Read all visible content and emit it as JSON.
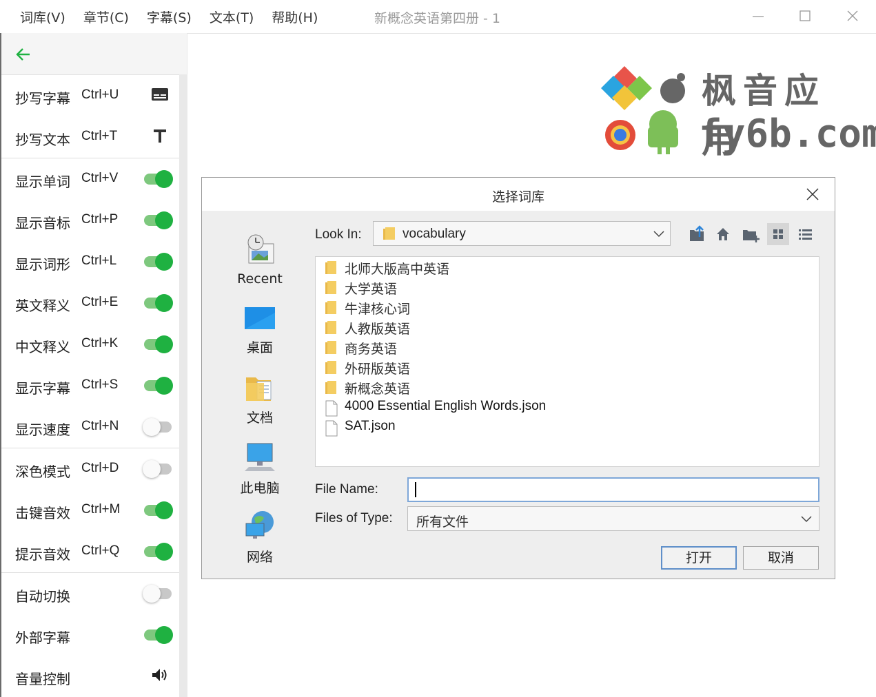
{
  "menubar": {
    "items": [
      "词库(V)",
      "章节(C)",
      "字幕(S)",
      "文本(T)",
      "帮助(H)"
    ],
    "window_title": "新概念英语第四册 - 1"
  },
  "sidebar": {
    "rows": [
      {
        "label": "抄写字幕",
        "shortcut": "Ctrl+U",
        "control": "subtitle-icon"
      },
      {
        "label": "抄写文本",
        "shortcut": "Ctrl+T",
        "control": "text-icon"
      },
      {
        "label": "显示单词",
        "shortcut": "Ctrl+V",
        "control": "toggle",
        "on": true
      },
      {
        "label": "显示音标",
        "shortcut": "Ctrl+P",
        "control": "toggle",
        "on": true
      },
      {
        "label": "显示词形",
        "shortcut": "Ctrl+L",
        "control": "toggle",
        "on": true
      },
      {
        "label": "英文释义",
        "shortcut": "Ctrl+E",
        "control": "toggle",
        "on": true
      },
      {
        "label": "中文释义",
        "shortcut": "Ctrl+K",
        "control": "toggle",
        "on": true
      },
      {
        "label": "显示字幕",
        "shortcut": "Ctrl+S",
        "control": "toggle",
        "on": true
      },
      {
        "label": "显示速度",
        "shortcut": "Ctrl+N",
        "control": "toggle",
        "on": false
      },
      {
        "label": "深色模式",
        "shortcut": "Ctrl+D",
        "control": "toggle",
        "on": false
      },
      {
        "label": "击键音效",
        "shortcut": "Ctrl+M",
        "control": "toggle",
        "on": true
      },
      {
        "label": "提示音效",
        "shortcut": "Ctrl+Q",
        "control": "toggle",
        "on": true
      },
      {
        "label": "自动切换",
        "shortcut": "",
        "control": "toggle",
        "on": false
      },
      {
        "label": "外部字幕",
        "shortcut": "",
        "control": "toggle",
        "on": true
      },
      {
        "label": "音量控制",
        "shortcut": "",
        "control": "volume-icon"
      }
    ],
    "accent_color": "#1fb141"
  },
  "watermark": {
    "line1": "枫音应用",
    "line2": "fy6b.com"
  },
  "dialog": {
    "title": "选择词库",
    "places": [
      "Recent",
      "桌面",
      "文档",
      "此电脑",
      "网络"
    ],
    "look_in_label": "Look In:",
    "look_in_value": "vocabulary",
    "toolbar_icons": [
      "up-folder-icon",
      "home-icon",
      "new-folder-icon",
      "list-view-icon",
      "details-view-icon"
    ],
    "entries": [
      {
        "name": "北师大版高中英语",
        "type": "folder"
      },
      {
        "name": "大学英语",
        "type": "folder"
      },
      {
        "name": "牛津核心词",
        "type": "folder"
      },
      {
        "name": "人教版英语",
        "type": "folder"
      },
      {
        "name": "商务英语",
        "type": "folder"
      },
      {
        "name": "外研版英语",
        "type": "folder"
      },
      {
        "name": "新概念英语",
        "type": "folder"
      },
      {
        "name": "4000 Essential English Words.json",
        "type": "file"
      },
      {
        "name": "SAT.json",
        "type": "file"
      }
    ],
    "file_name_label": "File Name:",
    "file_name_value": "",
    "file_type_label": "Files of Type:",
    "file_type_value": "所有文件",
    "open_button": "打开",
    "cancel_button": "取消"
  }
}
